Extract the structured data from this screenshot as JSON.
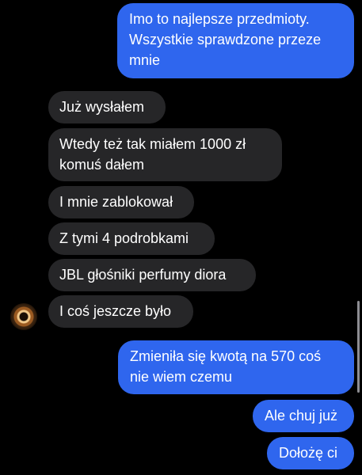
{
  "messages": [
    {
      "direction": "outgoing",
      "text": "Imo to najlepsze przedmioty.\nWszystkie sprawdzone przeze\nmnie"
    },
    {
      "direction": "incoming",
      "text": "Już wysłałem"
    },
    {
      "direction": "incoming",
      "text": "Wtedy też tak miałem 1000 zł\nkomuś dałem"
    },
    {
      "direction": "incoming",
      "text": "I mnie zablokował"
    },
    {
      "direction": "incoming",
      "text": "Z tymi 4 podrobkami"
    },
    {
      "direction": "incoming",
      "text": "JBL głośniki perfumy diora"
    },
    {
      "direction": "incoming",
      "text": "I coś jeszcze było"
    },
    {
      "direction": "outgoing",
      "text": "Zmieniła się kwotą na 570 coś\nnie wiem czemu"
    },
    {
      "direction": "outgoing",
      "text": "Ale chuj już"
    },
    {
      "direction": "outgoing",
      "text": "Dołożę ci"
    }
  ],
  "colors": {
    "background": "#000000",
    "outgoing_bubble": "#2f66ee",
    "incoming_bubble": "#262628",
    "text": "#ffffff"
  },
  "icons": {
    "avatar": "contact-avatar"
  }
}
